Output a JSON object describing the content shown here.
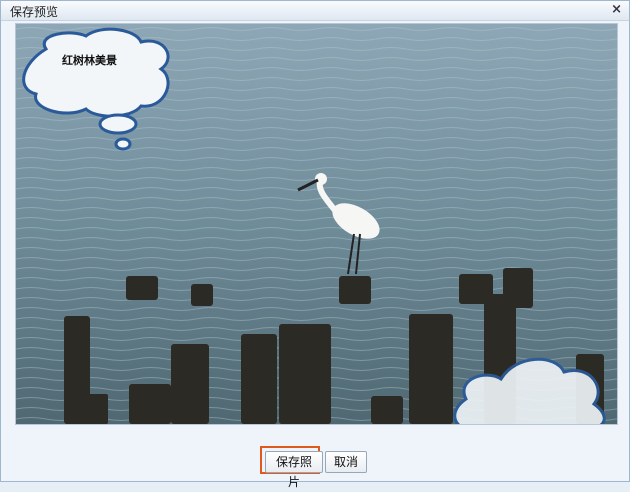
{
  "dialog": {
    "title": "保存预览",
    "close_symbol": "×"
  },
  "preview": {
    "speech_bubble_text": "红树林美景",
    "image_subject": "egret-on-post-over-water"
  },
  "buttons": {
    "save_label": "保存照片",
    "cancel_label": "取消"
  },
  "colors": {
    "focus_outline": "#e05a1c",
    "bubble_stroke": "#2a5a9a"
  }
}
